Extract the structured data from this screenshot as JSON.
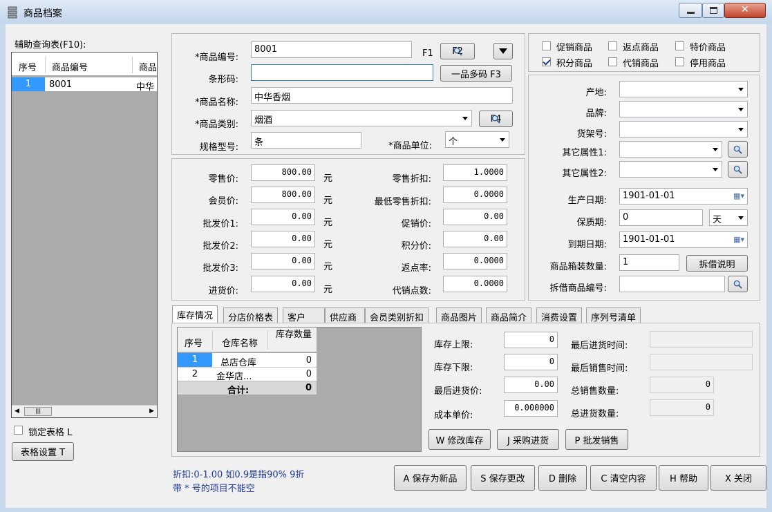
{
  "window": {
    "title": "商品档案"
  },
  "left": {
    "grid_title": "辅助查询表(F10):",
    "headers": [
      "序号",
      "商品编号",
      "商品"
    ],
    "rows": [
      [
        "1",
        "8001",
        "中华"
      ]
    ],
    "lock_label": "锁定表格 L",
    "settings_button": "表格设置 T"
  },
  "basic": {
    "code_label": "*商品编号:",
    "code_value": "8001",
    "f1_label": "F1",
    "f2_button": "F2",
    "barcode_label": "条形码:",
    "barcode_value": "",
    "multi_code_button": "一品多码 F3",
    "name_label": "*商品名称:",
    "name_value": "中华香烟",
    "category_label": "*商品类别:",
    "category_value": "烟酒",
    "f4_button": "F4",
    "spec_label": "规格型号:",
    "spec_value": "条",
    "unit_label": "*商品单位:",
    "unit_value": "个"
  },
  "flags": {
    "promo": "促销商品",
    "rebate": "返点商品",
    "special": "特价商品",
    "points": "积分商品",
    "consign": "代销商品",
    "disabled": "停用商品"
  },
  "prices": {
    "retail_label": "零售价:",
    "retail_value": "800.00",
    "member_label": "会员价:",
    "member_value": "800.00",
    "wholesale1_label": "批发价1:",
    "wholesale1_value": "0.00",
    "wholesale2_label": "批发价2:",
    "wholesale2_value": "0.00",
    "wholesale3_label": "批发价3:",
    "wholesale3_value": "0.00",
    "purchase_label": "进货价:",
    "purchase_value": "0.00",
    "yuan": "元",
    "retail_discount_label": "零售折扣:",
    "retail_discount_value": "1.0000",
    "min_discount_label": "最低零售折扣:",
    "min_discount_value": "0.0000",
    "promo_price_label": "促销价:",
    "promo_price_value": "0.00",
    "points_price_label": "积分价:",
    "points_price_value": "0.00",
    "rebate_rate_label": "返点率:",
    "rebate_rate_value": "0.0000",
    "consign_points_label": "代销点数:",
    "consign_points_value": "0.0000"
  },
  "attrs": {
    "origin_label": "产地:",
    "brand_label": "品牌:",
    "shelf_label": "货架号:",
    "other1_label": "其它属性1:",
    "other2_label": "其它属性2:",
    "mfg_date_label": "生产日期:",
    "mfg_date_value": "1901-01-01",
    "shelf_life_label": "保质期:",
    "shelf_life_value": "0",
    "shelf_life_unit": "天",
    "expiry_label": "到期日期:",
    "expiry_value": "1901-01-01",
    "box_qty_label": "商品箱装数量:",
    "box_qty_value": "1",
    "split_button": "拆借说明",
    "split_code_label": "拆借商品编号:",
    "split_code_value": ""
  },
  "tabs": [
    "库存情况",
    "分店价格表",
    "客户",
    "供应商",
    "会员类别折扣",
    "商品图片",
    "商品简介",
    "消费设置",
    "序列号清单"
  ],
  "stock": {
    "headers": [
      "序号",
      "仓库名称",
      "库存数量"
    ],
    "rows": [
      [
        "1",
        "总店仓库",
        "0"
      ],
      [
        "2",
        "金华店...",
        "0"
      ]
    ],
    "total_label": "合计:",
    "total_value": "0",
    "upper_label": "库存上限:",
    "upper_value": "0",
    "lower_label": "库存下限:",
    "lower_value": "0",
    "last_price_label": "最后进货价:",
    "last_price_value": "0.00",
    "cost_label": "成本单价:",
    "cost_value": "0.000000",
    "last_in_time_label": "最后进货时间:",
    "last_in_time_value": "",
    "last_sale_time_label": "最后销售时间:",
    "last_sale_time_value": "",
    "total_sales_label": "总销售数量:",
    "total_sales_value": "0",
    "total_in_label": "总进货数量:",
    "total_in_value": "0",
    "modify_button": "W 修改库存",
    "purchase_button": "J 采购进货",
    "wholesale_button": "P 批发销售"
  },
  "footer": {
    "note1": "折扣:0-1.00 如0.9是指90%  9折",
    "note2": "带 * 号的项目不能空",
    "save_new": "A 保存为新品",
    "save_change": "S 保存更改",
    "delete": "D 删除",
    "clear": "C 清空内容",
    "help": "H 帮助",
    "close": "X 关闭"
  }
}
